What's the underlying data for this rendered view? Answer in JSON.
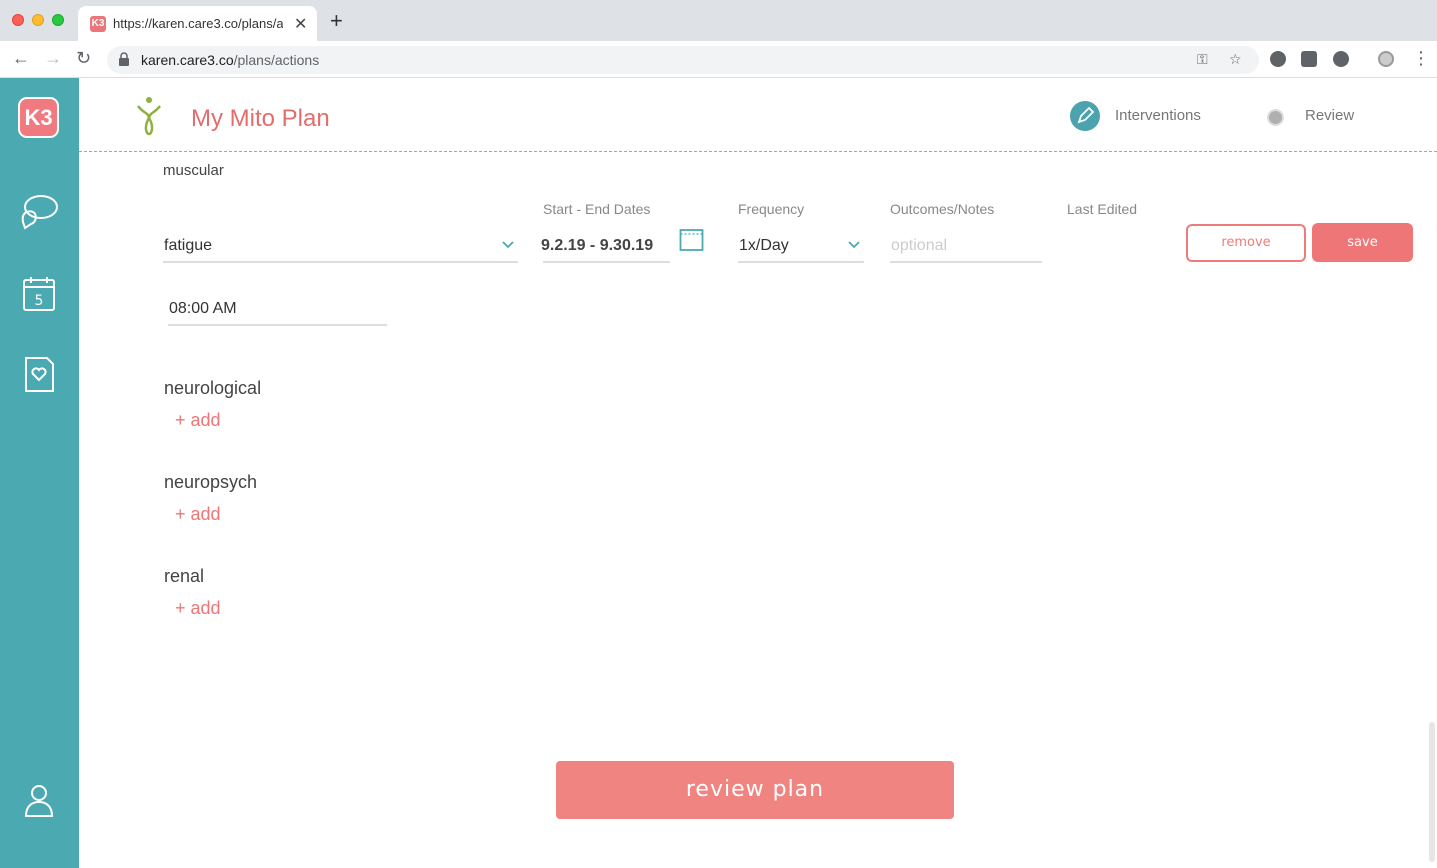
{
  "browser": {
    "tab_title": "https://karen.care3.co/plans/actions",
    "tab_favicon": "K3",
    "url_host": "karen.care3.co",
    "url_path": "/plans/actions"
  },
  "sidebar": {
    "logo": "K3",
    "items": [
      "chat-icon",
      "calendar-icon",
      "care-plan-icon",
      "profile-icon"
    ]
  },
  "header": {
    "title": "My Mito Plan",
    "steps": [
      {
        "label": "Interventions",
        "active": true
      },
      {
        "label": "Review",
        "active": false
      }
    ]
  },
  "muscular": {
    "title": "muscular",
    "columns": {
      "dates": "Start - End Dates",
      "frequency": "Frequency",
      "notes": "Outcomes/Notes",
      "edited": "Last Edited"
    },
    "symptom": "fatigue",
    "dates": "9.2.19 - 9.30.19",
    "frequency": "1x/Day",
    "notes_placeholder": "optional",
    "time": "08:00 AM",
    "remove_label": "remove",
    "save_label": "save"
  },
  "sections": [
    {
      "title": "neurological",
      "add_label": "+ add"
    },
    {
      "title": "neuropsych",
      "add_label": "+ add"
    },
    {
      "title": "renal",
      "add_label": "+ add"
    }
  ],
  "review_label": "review plan",
  "colors": {
    "teal": "#4ba9b2",
    "coral": "#ee7676"
  }
}
